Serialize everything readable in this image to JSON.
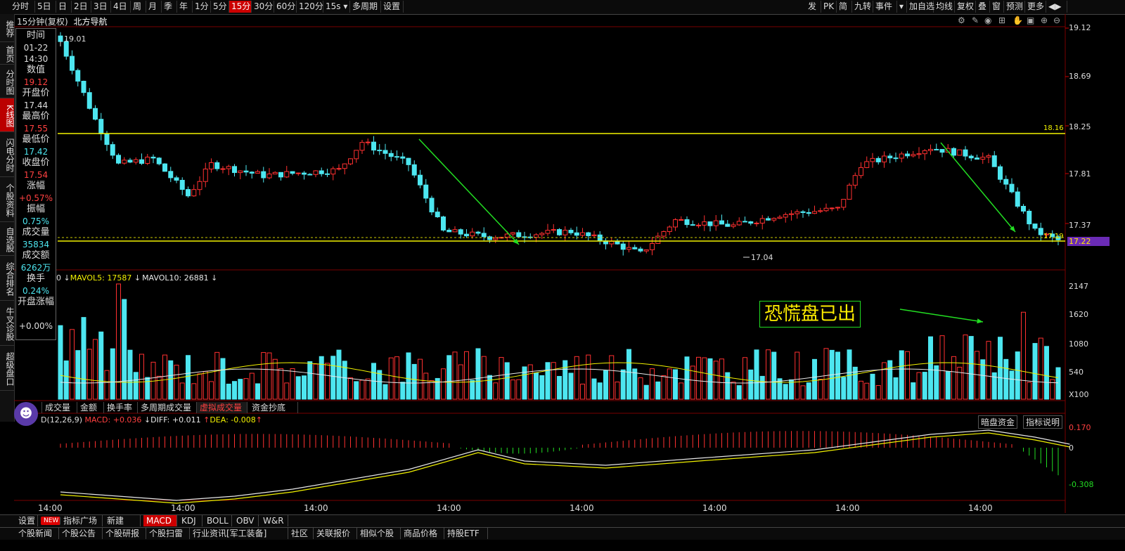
{
  "toolbar": {
    "left": [
      "分时",
      "5日",
      "日",
      "2日",
      "3日",
      "4日",
      "周",
      "月",
      "季",
      "年",
      "1分",
      "5分",
      "15分",
      "30分",
      "60分",
      "120分",
      "15s ▾",
      "多周期",
      "设置"
    ],
    "active": "15分",
    "right": [
      "发",
      "PK",
      "简",
      "九转",
      "事件",
      "▾",
      "加自选",
      "均线",
      "复权",
      "叠",
      "窗",
      "预测",
      "更多",
      "◀▶"
    ]
  },
  "leftnav": [
    "推荐",
    "首页",
    "分时图",
    "K线图",
    "闪电分时",
    "个股资料",
    "自选股",
    "综合排名",
    "牛叉诊股",
    "超级盘口"
  ],
  "leftnav_active": "K线图",
  "chart_header": {
    "period": "15分钟(复权)",
    "name": "北方导航"
  },
  "info_panel": [
    {
      "label": "时间",
      "value": "01-22"
    },
    {
      "label": "",
      "value": "14:30"
    },
    {
      "label": "数值",
      "value": "19.12"
    },
    {
      "label": "开盘价",
      "value": "17.44"
    },
    {
      "label": "最高价",
      "value": "17.55"
    },
    {
      "label": "最低价",
      "value": "17.42"
    },
    {
      "label": "收盘价",
      "value": "17.54"
    },
    {
      "label": "涨幅",
      "value": "+0.57%"
    },
    {
      "label": "振幅",
      "value": "0.75%"
    },
    {
      "label": "成交量",
      "value": "35834"
    },
    {
      "label": "成交额",
      "value": "6262万"
    },
    {
      "label": "换手",
      "value": "0.24%"
    },
    {
      "label": "开盘涨幅",
      "value": "+0.00%"
    }
  ],
  "colors": {
    "up": "#ff3030",
    "down": "#4de6f0",
    "yellow": "#f2f200",
    "green": "#22dd22",
    "white": "#e8e8e8"
  },
  "price_axis": {
    "labels": [
      "19.12",
      "18.69",
      "18.25",
      "17.81",
      "17.37"
    ],
    "marker": "17.22",
    "line_high": "18.16",
    "line_low": "17.19",
    "peak": "19.01",
    "trough": "17.04"
  },
  "volume_axis": {
    "labels": [
      "2147",
      "1620",
      "1080",
      "540"
    ],
    "unit": "X100"
  },
  "macd_axis": {
    "labels": [
      "0.170",
      "0",
      "-0.308"
    ]
  },
  "vol_header": {
    "mavol5": "MAVOL5: 17587",
    "mavol10": "MAVOL10: 26881"
  },
  "annotation": "恐慌盘已出",
  "sub_tabs": [
    "量",
    "成交量",
    "金额",
    "换手率",
    "多周期成交量",
    "虚拟成交量",
    "资金抄底"
  ],
  "sub_tab_active": "虚拟成交量",
  "macd_header": {
    "name": "D(12,26,9)",
    "macd": "MACD: +0.036",
    "diff": "DIFF: +0.011",
    "dea": "DEA: -0.008"
  },
  "macd_buttons": [
    "暗盘资金",
    "指标说明"
  ],
  "time_axis": [
    "14:00",
    "14:00",
    "14:00",
    "14:00",
    "14:00",
    "14:00",
    "14:00",
    "14:00"
  ],
  "indicator_bar": {
    "settings": "设置",
    "new_badge": "NEW",
    "plaza": "指标广场",
    "create": "新建",
    "items": [
      "MACD",
      "KDJ",
      "BOLL",
      "OBV",
      "W&R"
    ],
    "active": "MACD"
  },
  "info_bar": [
    "个股新闻",
    "个股公告",
    "个股研报",
    "个股扫雷",
    "行业资讯[军工装备]",
    "社区",
    "关联报价",
    "相似个股",
    "商品价格",
    "持股ETF"
  ]
}
